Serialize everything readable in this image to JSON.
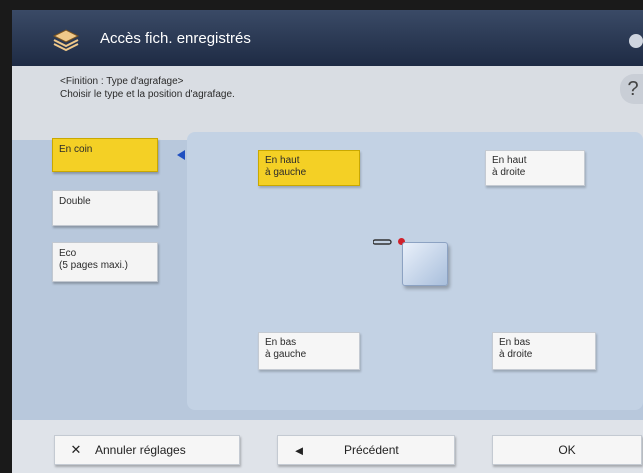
{
  "header": {
    "title": "Accès fich. enregistrés",
    "title_icon": "stapled-files-icon",
    "settings_icon": "gear-icon"
  },
  "instructions": {
    "line1": "<Finition : Type d'agrafage>",
    "line2": "Choisir le type et la position d'agrafage."
  },
  "help": {
    "label": "?"
  },
  "staple_types": [
    {
      "label": "En coin",
      "selected": true
    },
    {
      "label": "Double",
      "selected": false
    },
    {
      "label": "Eco\n(5 pages maxi.)",
      "selected": false
    }
  ],
  "positions": {
    "top_left": {
      "label": "En haut\nà gauche",
      "selected": true
    },
    "top_right": {
      "label": "En haut\nà droite",
      "selected": false
    },
    "bottom_left": {
      "label": "En bas\nà gauche",
      "selected": false
    },
    "bottom_right": {
      "label": "En bas\nà droite",
      "selected": false
    }
  },
  "footer": {
    "cancel_label": "Annuler réglages",
    "previous_label": "Précédent",
    "ok_label": "OK"
  },
  "colors": {
    "selected": "#f4d025",
    "panel": "#b8c8dc",
    "titlebar": "#1e2b44",
    "staple_dot": "#d0202a"
  }
}
